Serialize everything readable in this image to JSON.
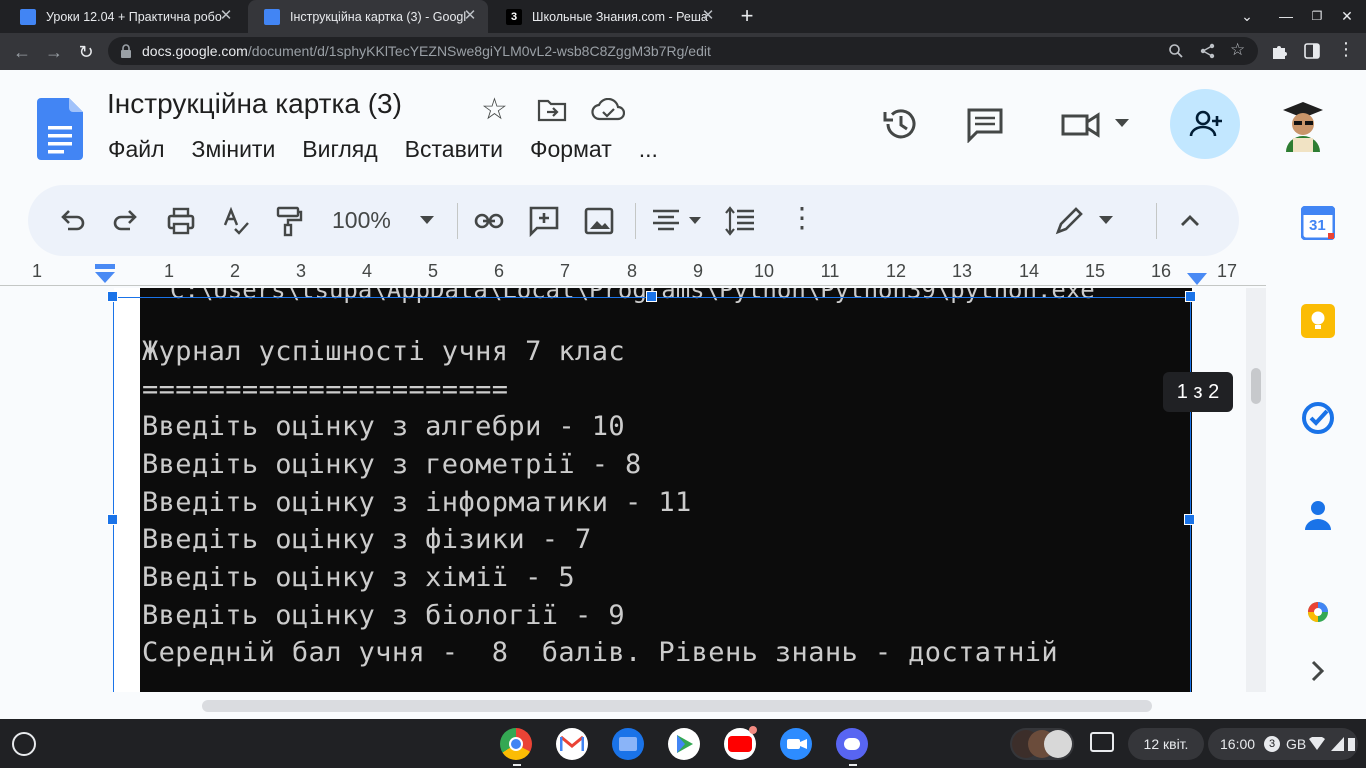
{
  "browser": {
    "tabs": [
      {
        "title": "Уроки 12.04 + Практична робо",
        "favicon_color": "#4285f4"
      },
      {
        "title": "Інструкційна картка (3) - Googl",
        "favicon_color": "#4285f4",
        "active": true
      },
      {
        "title": "Школьные Знания.com - Реша",
        "favicon_color": "#000000",
        "favicon_text": "3"
      }
    ],
    "new_tab_label": "+",
    "address": {
      "domain": "docs.google.com",
      "path": "/document/d/1sphyKKlTecYEZNSwe8giYLM0vL2-wsb8C8ZggM3b7Rg/edit"
    }
  },
  "docs": {
    "title": "Інструкційна картка (3)",
    "menu": [
      "Файл",
      "Змінити",
      "Вигляд",
      "Вставити",
      "Формат",
      "..."
    ],
    "zoom": "100%",
    "ruler_labels": [
      "1",
      "1",
      "2",
      "3",
      "4",
      "5",
      "6",
      "7",
      "8",
      "9",
      "10",
      "11",
      "12",
      "13",
      "14",
      "15",
      "16",
      "17"
    ],
    "page_indicator": "1 з 2",
    "calendar_day": "31"
  },
  "console": {
    "title_partial": "C:\\Users\\tsupa\\AppData\\Local\\Programs\\Python\\Python39\\python.exe",
    "lines": [
      "Журнал успішності учня 7 клас",
      "======================",
      "Введіть оцінку з алгебри - 10",
      "Введіть оцінку з геометрії - 8",
      "Введіть оцінку з інформатики - 11",
      "Введіть оцінку з фізики - 7",
      "Введіть оцінку з хімії - 5",
      "Введіть оцінку з біології - 9",
      "Середній бал учня -  8  балів. Рівень знань - достатній"
    ]
  },
  "shelf": {
    "date": "12 квіт.",
    "time": "16:00",
    "notifications": "3",
    "keyboard_layout": "GB"
  },
  "colors": {
    "accent": "#1a73e8",
    "toolbar_bg": "#edf2fa",
    "share_bg": "#c2e7ff"
  }
}
